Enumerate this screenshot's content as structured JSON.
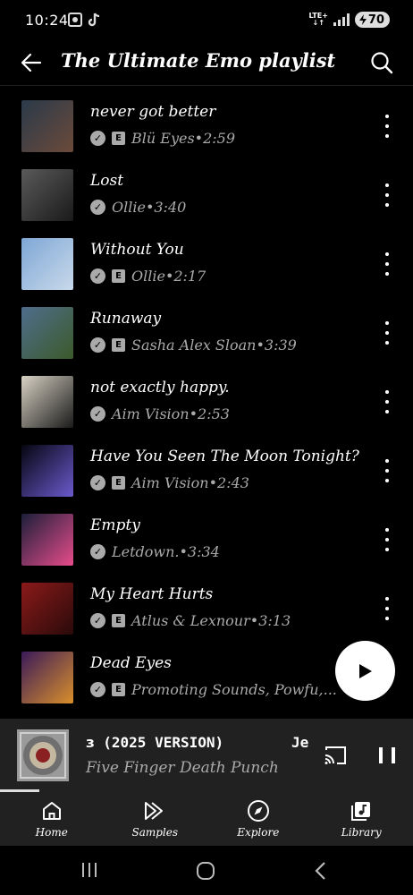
{
  "status_bar": {
    "time": "10:24",
    "network": "LTE+",
    "battery": "70"
  },
  "header": {
    "title": "The Ultimate Emo playlist"
  },
  "songs": [
    {
      "title": "never got better",
      "explicit": true,
      "artist": "Blü Eyes",
      "duration": "2:59",
      "art_colors": [
        "#2a3a4a",
        "#6b4a3a"
      ]
    },
    {
      "title": "Lost",
      "explicit": false,
      "artist": "Ollie",
      "duration": "3:40",
      "art_colors": [
        "#5a5a5a",
        "#1a1a1a"
      ]
    },
    {
      "title": "Without You",
      "explicit": true,
      "artist": "Ollie",
      "duration": "2:17",
      "art_colors": [
        "#7ea7d6",
        "#c9d9ea"
      ]
    },
    {
      "title": "Runaway",
      "explicit": true,
      "artist": "Sasha Alex Sloan",
      "duration": "3:39",
      "art_colors": [
        "#4f6d8c",
        "#3b5a2a"
      ]
    },
    {
      "title": "not exactly happy.",
      "explicit": false,
      "artist": "Aim Vision",
      "duration": "2:53",
      "art_colors": [
        "#d8d2c4",
        "#1a1a1a"
      ]
    },
    {
      "title": "Have You Seen The Moon Tonight?",
      "explicit": true,
      "artist": "Aim Vision",
      "duration": "2:43",
      "art_colors": [
        "#050510",
        "#6a5acd"
      ]
    },
    {
      "title": "Empty",
      "explicit": false,
      "artist": "Letdown.",
      "duration": "3:34",
      "art_colors": [
        "#1b1f3a",
        "#e84c8b"
      ]
    },
    {
      "title": "My Heart Hurts",
      "explicit": true,
      "artist": "Atlus & Lexnour",
      "duration": "3:13",
      "art_colors": [
        "#8b1a1a",
        "#2a0a0a"
      ]
    },
    {
      "title": "Dead Eyes",
      "explicit": true,
      "artist": "Promoting Sounds, Powfu,...",
      "duration": "",
      "art_colors": [
        "#3a1a5a",
        "#d98f2a"
      ]
    }
  ],
  "mini_player": {
    "title_fragment": "ɜ (2025 VERSION)",
    "title_next": "Je",
    "artist": "Five Finger Death Punch",
    "progress": 0.095
  },
  "nav": [
    {
      "label": "Home",
      "icon": "home-icon"
    },
    {
      "label": "Samples",
      "icon": "samples-icon"
    },
    {
      "label": "Explore",
      "icon": "compass-icon"
    },
    {
      "label": "Library",
      "icon": "library-icon"
    }
  ],
  "colors": {
    "background": "#000000",
    "mini_player_bg": "#212121",
    "secondary_text": "#aaaaaa"
  }
}
